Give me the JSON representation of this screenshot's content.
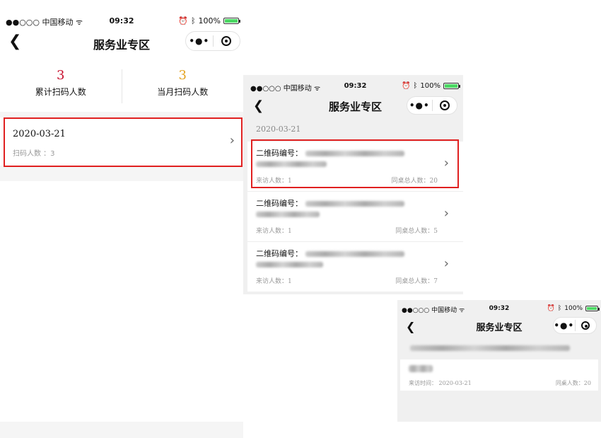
{
  "status": {
    "carrier": "●●○○○ 中国移动 ᯤ",
    "time": "09:32",
    "battery_percent": "100%"
  },
  "nav": {
    "title": "服务业专区"
  },
  "screen1": {
    "stats": [
      {
        "value": "3",
        "label": "累计扫码人数",
        "color": "#c8102e"
      },
      {
        "value": "3",
        "label": "当月扫码人数",
        "color": "#e4a320"
      }
    ],
    "record": {
      "date": "2020-03-21",
      "scan_label": "扫码人数 ：3"
    }
  },
  "screen2": {
    "section_date": "2020-03-21",
    "items": [
      {
        "code_label": "二维码编号：",
        "visitors": "来访人数：1",
        "table_total": "同桌总人数：20"
      },
      {
        "code_label": "二维码编号：",
        "visitors": "来访人数：1",
        "table_total": "同桌总人数：5"
      },
      {
        "code_label": "二维码编号：",
        "visitors": "来访人数：1",
        "table_total": "同桌总人数：7"
      }
    ]
  },
  "screen3": {
    "visit_time": "来访时间： 2020-03-21",
    "table_people": "同桌人数：20"
  }
}
